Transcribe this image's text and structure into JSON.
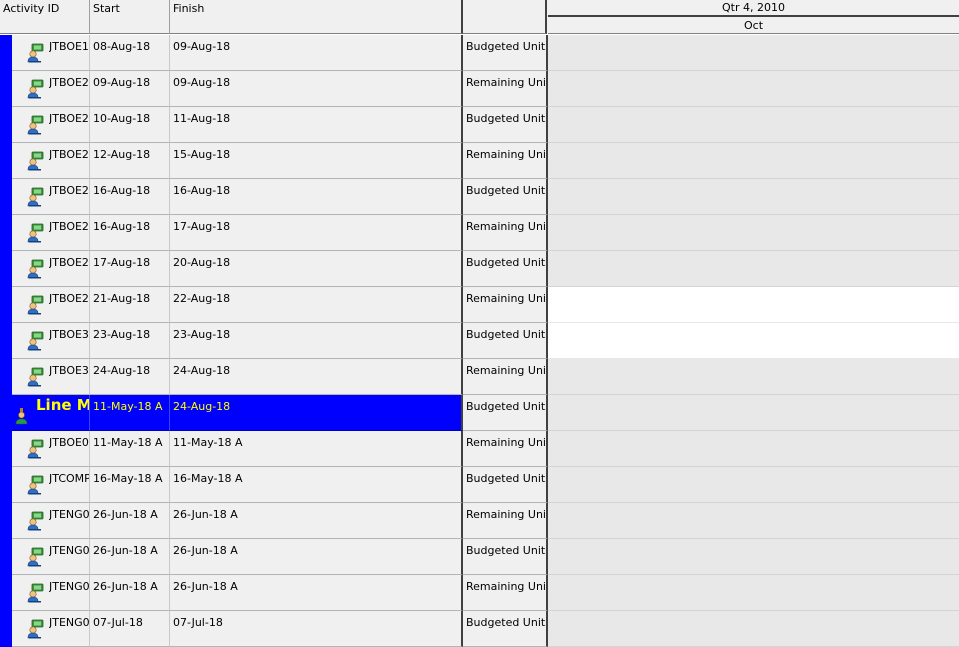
{
  "header": {
    "col_activity_id": "Activity ID",
    "col_start": "Start",
    "col_finish": "Finish",
    "col_units": "",
    "timescale_top": "Qtr 4, 2010",
    "timescale_bottom": "Oct"
  },
  "colors": {
    "wbs_band": "#0000ff",
    "wbs_text": "#ffff00",
    "grid_bg": "#f0f0f0",
    "gantt_bg": "#e8e8e8"
  },
  "rows": [
    {
      "type": "activity",
      "id": "JTBOE1",
      "start": "08-Aug-18",
      "finish": "09-Aug-18",
      "units": "Budgeted Units",
      "icon": "activity-resource-icon",
      "gantt": "shaded"
    },
    {
      "type": "activity",
      "id": "JTBOE2",
      "start": "09-Aug-18",
      "finish": "09-Aug-18",
      "units": "Remaining Units",
      "icon": "activity-resource-icon",
      "gantt": "shaded"
    },
    {
      "type": "activity",
      "id": "JTBOE2",
      "start": "10-Aug-18",
      "finish": "11-Aug-18",
      "units": "Budgeted Units",
      "icon": "activity-resource-icon",
      "gantt": "shaded"
    },
    {
      "type": "activity",
      "id": "JTBOE2",
      "start": "12-Aug-18",
      "finish": "15-Aug-18",
      "units": "Remaining Units",
      "icon": "activity-resource-icon",
      "gantt": "shaded"
    },
    {
      "type": "activity",
      "id": "JTBOE2",
      "start": "16-Aug-18",
      "finish": "16-Aug-18",
      "units": "Budgeted Units",
      "icon": "activity-resource-icon",
      "gantt": "shaded"
    },
    {
      "type": "activity",
      "id": "JTBOE2",
      "start": "16-Aug-18",
      "finish": "17-Aug-18",
      "units": "Remaining Units",
      "icon": "activity-resource-icon",
      "gantt": "shaded"
    },
    {
      "type": "activity",
      "id": "JTBOE2",
      "start": "17-Aug-18",
      "finish": "20-Aug-18",
      "units": "Budgeted Units",
      "icon": "activity-resource-icon",
      "gantt": "shaded"
    },
    {
      "type": "activity",
      "id": "JTBOE2",
      "start": "21-Aug-18",
      "finish": "22-Aug-18",
      "units": "Remaining Units",
      "icon": "activity-resource-icon",
      "gantt": "white"
    },
    {
      "type": "activity",
      "id": "JTBOE3",
      "start": "23-Aug-18",
      "finish": "23-Aug-18",
      "units": "Budgeted Units",
      "icon": "activity-resource-icon",
      "gantt": "white"
    },
    {
      "type": "activity",
      "id": "JTBOE3",
      "start": "24-Aug-18",
      "finish": "24-Aug-18",
      "units": "Remaining Units",
      "icon": "activity-resource-icon",
      "gantt": "shaded"
    },
    {
      "type": "wbs",
      "id": "Line Ma",
      "start": "11-May-18 A",
      "finish": "24-Aug-18",
      "units": "Budgeted Units",
      "icon": "wbs-resource-icon",
      "gantt": "shaded"
    },
    {
      "type": "activity",
      "id": "JTBOE0",
      "start": "11-May-18 A",
      "finish": "11-May-18 A",
      "units": "Remaining Units",
      "icon": "activity-resource-icon",
      "gantt": "shaded"
    },
    {
      "type": "activity",
      "id": "JTCOMP",
      "start": "16-May-18 A",
      "finish": "16-May-18 A",
      "units": "Budgeted Units",
      "icon": "activity-resource-icon",
      "gantt": "shaded"
    },
    {
      "type": "activity",
      "id": "JTENG0",
      "start": "26-Jun-18 A",
      "finish": "26-Jun-18 A",
      "units": "Remaining Units",
      "icon": "activity-resource-icon",
      "gantt": "shaded"
    },
    {
      "type": "activity",
      "id": "JTENG0",
      "start": "26-Jun-18 A",
      "finish": "26-Jun-18 A",
      "units": "Budgeted Units",
      "icon": "activity-resource-icon",
      "gantt": "shaded"
    },
    {
      "type": "activity",
      "id": "JTENG0",
      "start": "26-Jun-18 A",
      "finish": "26-Jun-18 A",
      "units": "Remaining Units",
      "icon": "activity-resource-icon",
      "gantt": "shaded"
    },
    {
      "type": "activity",
      "id": "JTENG0",
      "start": "07-Jul-18",
      "finish": "07-Jul-18",
      "units": "Budgeted Units",
      "icon": "activity-resource-icon",
      "gantt": "shaded"
    }
  ]
}
